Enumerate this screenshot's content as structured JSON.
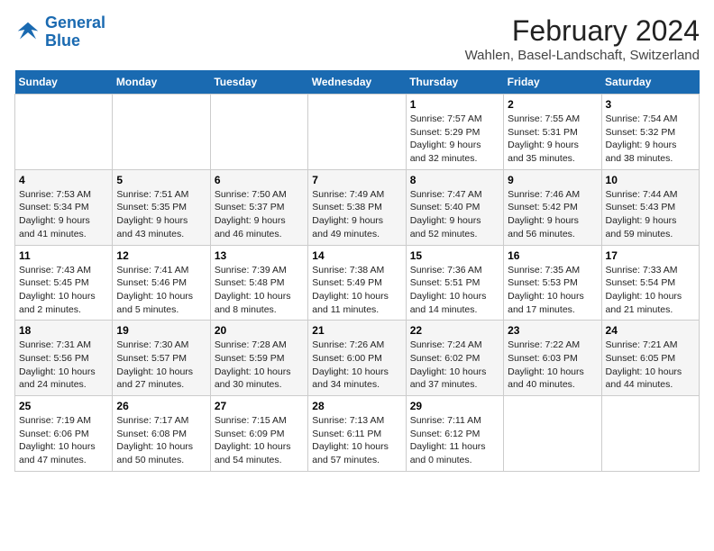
{
  "header": {
    "logo_line1": "General",
    "logo_line2": "Blue",
    "main_title": "February 2024",
    "subtitle": "Wahlen, Basel-Landschaft, Switzerland"
  },
  "weekdays": [
    "Sunday",
    "Monday",
    "Tuesday",
    "Wednesday",
    "Thursday",
    "Friday",
    "Saturday"
  ],
  "weeks": [
    [
      {
        "day": "",
        "info": ""
      },
      {
        "day": "",
        "info": ""
      },
      {
        "day": "",
        "info": ""
      },
      {
        "day": "",
        "info": ""
      },
      {
        "day": "1",
        "info": "Sunrise: 7:57 AM\nSunset: 5:29 PM\nDaylight: 9 hours\nand 32 minutes."
      },
      {
        "day": "2",
        "info": "Sunrise: 7:55 AM\nSunset: 5:31 PM\nDaylight: 9 hours\nand 35 minutes."
      },
      {
        "day": "3",
        "info": "Sunrise: 7:54 AM\nSunset: 5:32 PM\nDaylight: 9 hours\nand 38 minutes."
      }
    ],
    [
      {
        "day": "4",
        "info": "Sunrise: 7:53 AM\nSunset: 5:34 PM\nDaylight: 9 hours\nand 41 minutes."
      },
      {
        "day": "5",
        "info": "Sunrise: 7:51 AM\nSunset: 5:35 PM\nDaylight: 9 hours\nand 43 minutes."
      },
      {
        "day": "6",
        "info": "Sunrise: 7:50 AM\nSunset: 5:37 PM\nDaylight: 9 hours\nand 46 minutes."
      },
      {
        "day": "7",
        "info": "Sunrise: 7:49 AM\nSunset: 5:38 PM\nDaylight: 9 hours\nand 49 minutes."
      },
      {
        "day": "8",
        "info": "Sunrise: 7:47 AM\nSunset: 5:40 PM\nDaylight: 9 hours\nand 52 minutes."
      },
      {
        "day": "9",
        "info": "Sunrise: 7:46 AM\nSunset: 5:42 PM\nDaylight: 9 hours\nand 56 minutes."
      },
      {
        "day": "10",
        "info": "Sunrise: 7:44 AM\nSunset: 5:43 PM\nDaylight: 9 hours\nand 59 minutes."
      }
    ],
    [
      {
        "day": "11",
        "info": "Sunrise: 7:43 AM\nSunset: 5:45 PM\nDaylight: 10 hours\nand 2 minutes."
      },
      {
        "day": "12",
        "info": "Sunrise: 7:41 AM\nSunset: 5:46 PM\nDaylight: 10 hours\nand 5 minutes."
      },
      {
        "day": "13",
        "info": "Sunrise: 7:39 AM\nSunset: 5:48 PM\nDaylight: 10 hours\nand 8 minutes."
      },
      {
        "day": "14",
        "info": "Sunrise: 7:38 AM\nSunset: 5:49 PM\nDaylight: 10 hours\nand 11 minutes."
      },
      {
        "day": "15",
        "info": "Sunrise: 7:36 AM\nSunset: 5:51 PM\nDaylight: 10 hours\nand 14 minutes."
      },
      {
        "day": "16",
        "info": "Sunrise: 7:35 AM\nSunset: 5:53 PM\nDaylight: 10 hours\nand 17 minutes."
      },
      {
        "day": "17",
        "info": "Sunrise: 7:33 AM\nSunset: 5:54 PM\nDaylight: 10 hours\nand 21 minutes."
      }
    ],
    [
      {
        "day": "18",
        "info": "Sunrise: 7:31 AM\nSunset: 5:56 PM\nDaylight: 10 hours\nand 24 minutes."
      },
      {
        "day": "19",
        "info": "Sunrise: 7:30 AM\nSunset: 5:57 PM\nDaylight: 10 hours\nand 27 minutes."
      },
      {
        "day": "20",
        "info": "Sunrise: 7:28 AM\nSunset: 5:59 PM\nDaylight: 10 hours\nand 30 minutes."
      },
      {
        "day": "21",
        "info": "Sunrise: 7:26 AM\nSunset: 6:00 PM\nDaylight: 10 hours\nand 34 minutes."
      },
      {
        "day": "22",
        "info": "Sunrise: 7:24 AM\nSunset: 6:02 PM\nDaylight: 10 hours\nand 37 minutes."
      },
      {
        "day": "23",
        "info": "Sunrise: 7:22 AM\nSunset: 6:03 PM\nDaylight: 10 hours\nand 40 minutes."
      },
      {
        "day": "24",
        "info": "Sunrise: 7:21 AM\nSunset: 6:05 PM\nDaylight: 10 hours\nand 44 minutes."
      }
    ],
    [
      {
        "day": "25",
        "info": "Sunrise: 7:19 AM\nSunset: 6:06 PM\nDaylight: 10 hours\nand 47 minutes."
      },
      {
        "day": "26",
        "info": "Sunrise: 7:17 AM\nSunset: 6:08 PM\nDaylight: 10 hours\nand 50 minutes."
      },
      {
        "day": "27",
        "info": "Sunrise: 7:15 AM\nSunset: 6:09 PM\nDaylight: 10 hours\nand 54 minutes."
      },
      {
        "day": "28",
        "info": "Sunrise: 7:13 AM\nSunset: 6:11 PM\nDaylight: 10 hours\nand 57 minutes."
      },
      {
        "day": "29",
        "info": "Sunrise: 7:11 AM\nSunset: 6:12 PM\nDaylight: 11 hours\nand 0 minutes."
      },
      {
        "day": "",
        "info": ""
      },
      {
        "day": "",
        "info": ""
      }
    ]
  ],
  "colors": {
    "header_bg": "#1a6ab1",
    "logo_blue": "#1a6ab1"
  }
}
